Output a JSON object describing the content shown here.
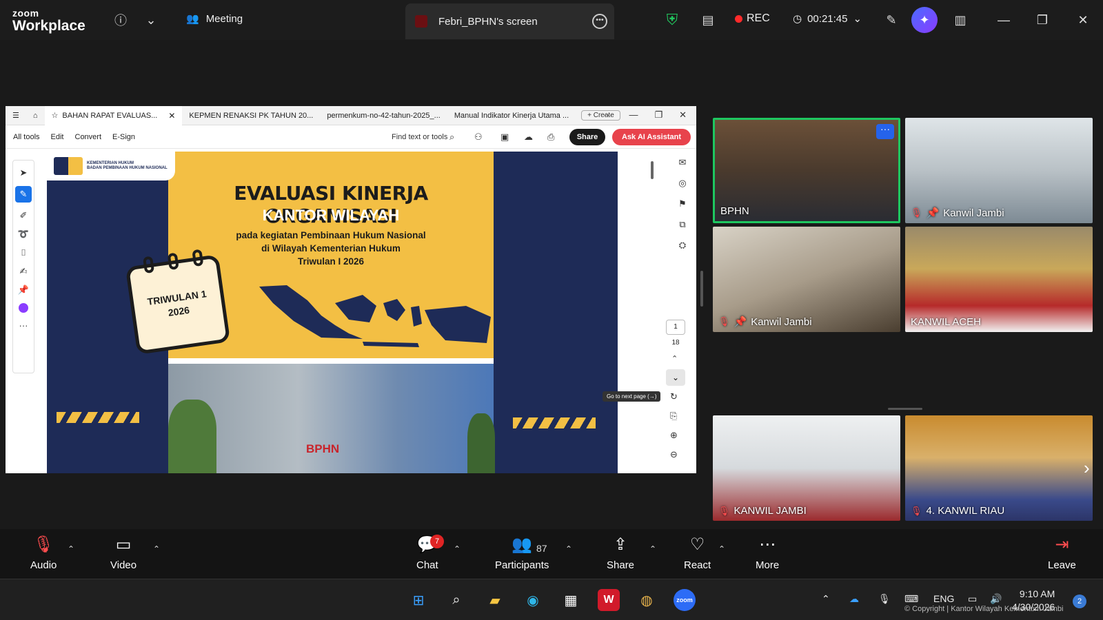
{
  "zoom": {
    "logo_top": "zoom",
    "logo_bottom": "Workplace",
    "meeting_label": "Meeting",
    "screen_share_label": "Febri_BPHN's screen",
    "rec_label": "REC",
    "timer": "00:21:45"
  },
  "browser": {
    "tabs": [
      {
        "label": "BAHAN RAPAT EVALUAS..."
      },
      {
        "label": "KEPMEN RENAKSI PK TAHUN 20..."
      },
      {
        "label": "permenkum-no-42-tahun-2025_..."
      },
      {
        "label": "Manual Indikator Kinerja Utama ..."
      }
    ],
    "create_label": "+ Create",
    "menu": [
      "All tools",
      "Edit",
      "Convert",
      "E-Sign"
    ],
    "find_label": "Find text or tools",
    "share_label": "Share",
    "ask_ai_label": "Ask AI Assistant",
    "page_current": "1",
    "page_total": "18",
    "tooltip": "Go to next page (→)"
  },
  "slide": {
    "logo_line1": "KEMENTERIAN HUKUM",
    "logo_line2": "BADAN PEMBINAAN HUKUM NASIONAL",
    "title": "EVALUASI KINERJA ORGANISASI",
    "subtitle": "KANTOR WILAYAH",
    "desc_line1": "pada kegiatan Pembinaan Hukum Nasional",
    "desc_line2": "di Wilayah Kementerian Hukum",
    "desc_line3": "Triwulan I 2026",
    "calendar_line1": "TRIWULAN 1",
    "calendar_line2": "2026",
    "sign": "BPHN"
  },
  "tiles": [
    {
      "name": "BPHN"
    },
    {
      "name": "Kanwil Jambi"
    },
    {
      "name": "Kanwil Jambi"
    },
    {
      "name": "KANWIL ACEH"
    },
    {
      "name": "KANWIL JAMBI"
    },
    {
      "name": "4. KANWIL RIAU"
    }
  ],
  "controls": {
    "audio": "Audio",
    "video": "Video",
    "chat": "Chat",
    "chat_badge": "7",
    "participants": "Participants",
    "participants_count": "87",
    "share": "Share",
    "react": "React",
    "more": "More",
    "leave": "Leave"
  },
  "taskbar": {
    "lang": "ENG",
    "time": "9:10 AM",
    "date": "4/30/2026",
    "notif_count": "2",
    "copyright": "© Copyright | Kantor Wilayah Kementum Jambi"
  },
  "colors": {
    "slide_navy": "#1e2b57",
    "slide_yellow": "#f3bf44",
    "active_speaker": "#1ec760",
    "ask_ai": "#e8434c",
    "rec": "#ff2a2a"
  }
}
